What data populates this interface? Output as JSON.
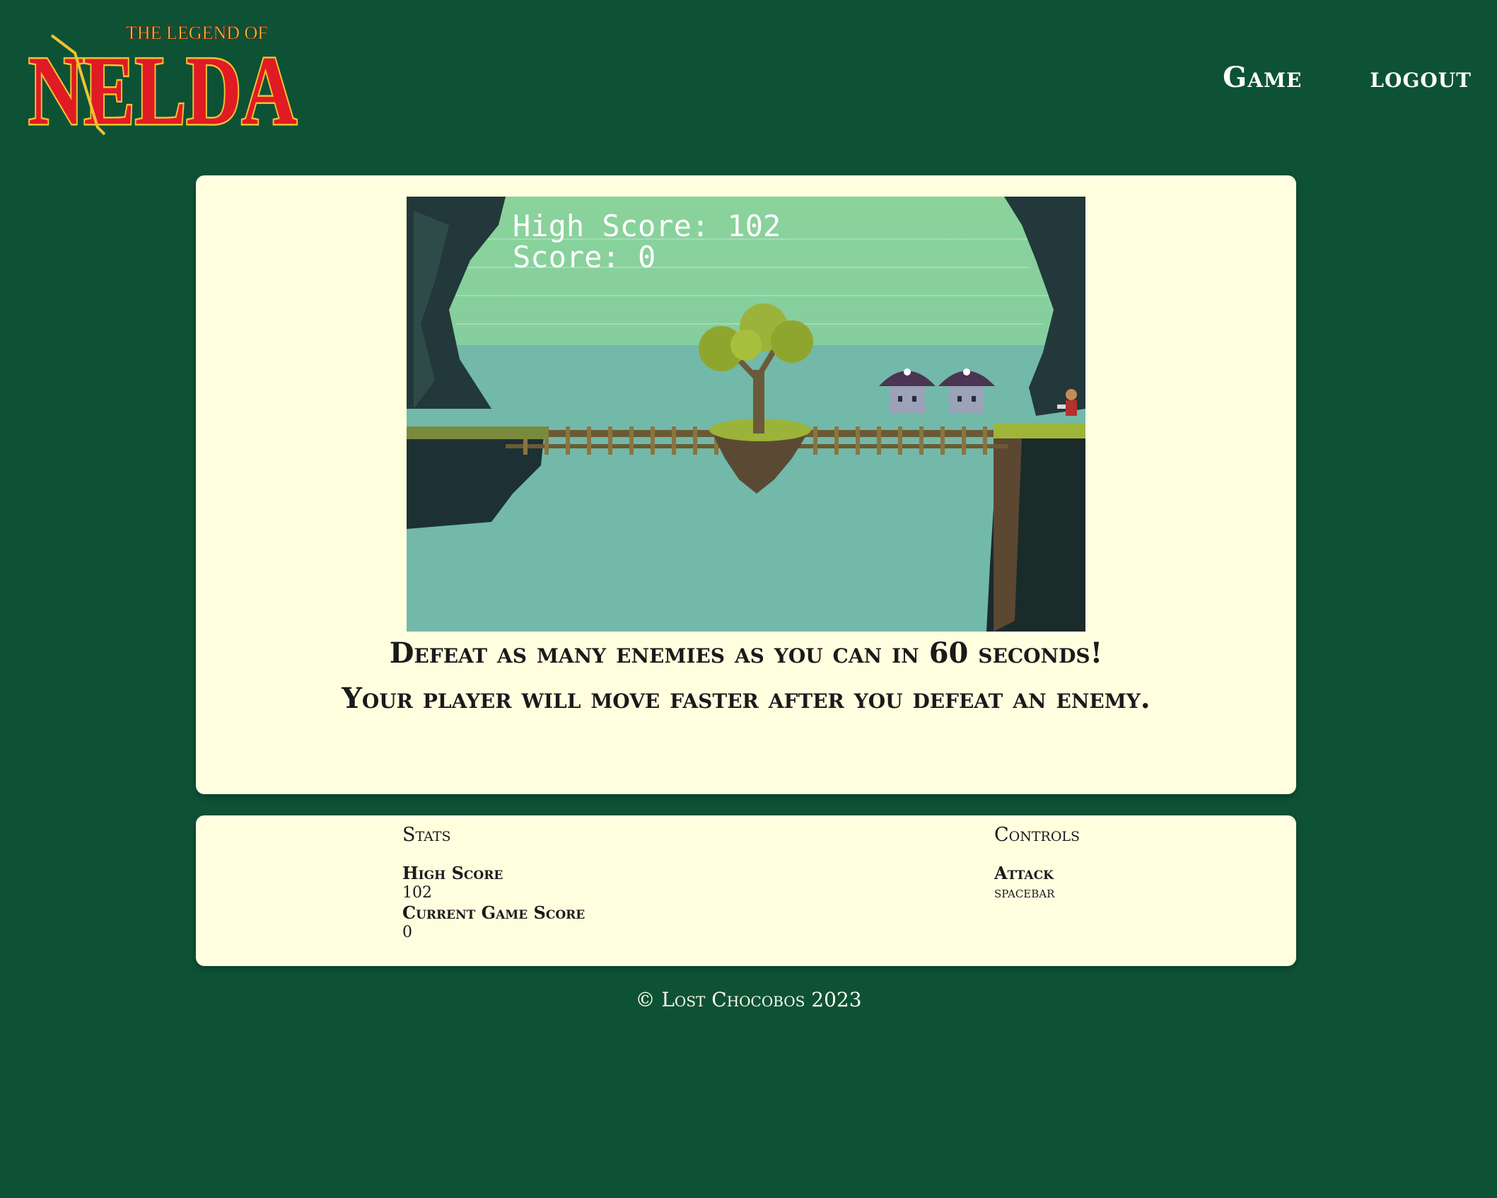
{
  "header": {
    "logo": {
      "top_text": "THE LEGEND OF",
      "main_text": "NELDA"
    },
    "nav": {
      "game": "Game",
      "logout": "logout"
    }
  },
  "game": {
    "hud_high_score": "High Score: 102",
    "hud_score": "Score: 0",
    "instruction_1": "Defeat as many enemies as you can in 60 seconds!",
    "instruction_2": "Your player will move faster after you defeat an enemy."
  },
  "stats": {
    "heading": "Stats",
    "high_score_label": "High Score",
    "high_score_value": "102",
    "current_label": "Current Game Score",
    "current_value": "0"
  },
  "controls": {
    "heading": "Controls",
    "attack_label": "Attack",
    "attack_value": "spacebar"
  },
  "footer": {
    "text": "© Lost Chocobos 2023"
  },
  "colors": {
    "background": "#0e5236",
    "card": "#ffffe0",
    "logo_red": "#e01b24",
    "logo_gold": "#f2c230",
    "sky": "#8ad39b",
    "water": "#72b9aa"
  }
}
